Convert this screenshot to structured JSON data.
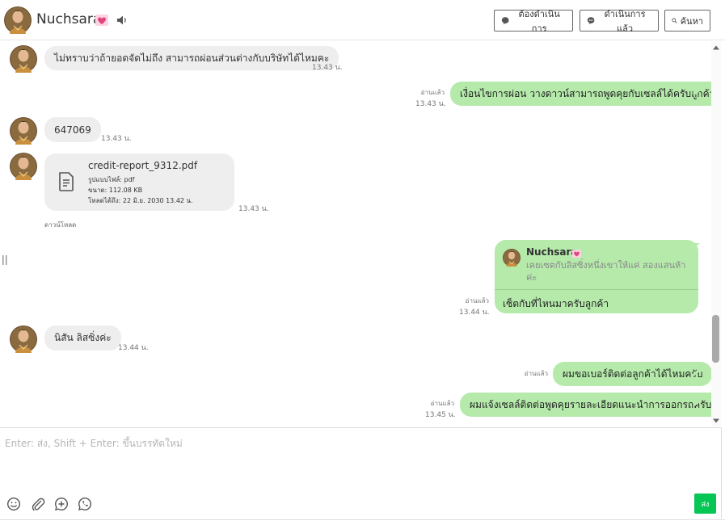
{
  "header": {
    "contact_name": "Nuchsara",
    "buttons": {
      "todo": "ต้องดำเนินการ",
      "done": "ดำเนินการแล้ว",
      "search": "ค้นหา"
    }
  },
  "messages": {
    "m1": {
      "text": "ไม่ทราบว่าถ้ายอดจัดไม่ถึง สามารถผ่อนส่วนต่างกับบริษัทได้ไหมคะ",
      "time": "13.43 น."
    },
    "m2": {
      "text": "เงื่อนไขการผ่อน วางดาวน์สามารถพูดคุยกับเซลล์ได้ครับลูกค้า",
      "read": "อ่านแล้ว",
      "time": "13.43 น."
    },
    "m3": {
      "text": "647069",
      "time": "13.43 น."
    },
    "m4": {
      "file_name": "credit-report_9312.pdf",
      "file_type": "รูปแบบไฟล์: pdf",
      "file_size": "ขนาด: 112.08 KB",
      "file_expiry": "โหลดได้ถึง: 22 มิ.ย. 2030 13.42 น.",
      "download_label": "ดาวน์โหลด",
      "time": "13.43 น."
    },
    "m5": {
      "reply_name": "Nuchsara",
      "reply_quote": "เคยเซตกับลิสซิ่งหนึ่งเขาให้แค่ สองแสนห้าค่ะ",
      "text": "เซ็ตกับที่ไหนมาครับลูกค้า",
      "read": "อ่านแล้ว",
      "time": "13.44 น."
    },
    "m6": {
      "text": "นิสัน ลิสซิ่งค่ะ",
      "time": "13.44 น."
    },
    "m7": {
      "text": "ผมขอเบอร์ติดต่อลูกค้าได้ไหมครับ",
      "read": "อ่านแล้ว"
    },
    "m8": {
      "text": "ผมแจ้งเซลล์ติดต่อพูดคุยรายละเอียดแนะนำการออกรถครับ",
      "read": "อ่านแล้ว",
      "time": "13.45 น."
    }
  },
  "composer": {
    "placeholder": "Enter: ส่ง, Shift + Enter: ขึ้นบรรทัดใหม่",
    "value": "",
    "send_label": "ส่ง",
    "tools": [
      "emoji-icon",
      "paperclip-icon",
      "plus-circle-icon",
      "phone-icon"
    ]
  },
  "colors": {
    "outgoing_bubble": "#b5eaab",
    "incoming_bubble": "#eeeeef",
    "send_button": "#06c755"
  }
}
